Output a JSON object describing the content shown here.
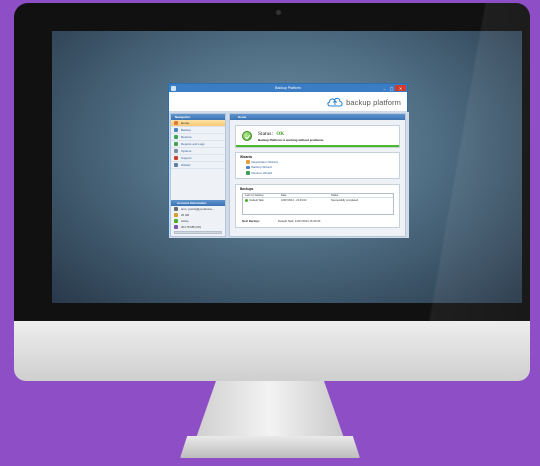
{
  "window": {
    "title": "Backup Platform",
    "controls": {
      "minimize": "–",
      "maximize": "▢",
      "close": "✕"
    }
  },
  "brand": {
    "name": "backup platform",
    "logo_icon": "cloud-upload-icon"
  },
  "nav": {
    "header": "Navigation",
    "items": [
      {
        "label": "Home",
        "icon": "home-icon",
        "color": "#e07b39",
        "active": true
      },
      {
        "label": "Backup",
        "icon": "backup-icon",
        "color": "#4a86c6"
      },
      {
        "label": "Restore",
        "icon": "restore-icon",
        "color": "#3aa35a"
      },
      {
        "label": "Reports and Logs",
        "icon": "report-icon",
        "color": "#4aa058"
      },
      {
        "label": "Options",
        "icon": "options-icon",
        "color": "#7a8fa6"
      },
      {
        "label": "Support",
        "icon": "support-icon",
        "color": "#c8402e"
      },
      {
        "label": "Wizard",
        "icon": "wizard-icon",
        "color": "#5c7fa8"
      }
    ]
  },
  "account": {
    "header": "Account Information",
    "rows": [
      {
        "text": "acm: yourdo@yourdoma...",
        "icon": "user-icon",
        "color": "#6b6b6b"
      },
      {
        "text": "25 GB",
        "icon": "storage-icon",
        "color": "#d89b2b"
      },
      {
        "text": "Active",
        "icon": "active-icon",
        "color": "#4fae2d"
      },
      {
        "text": "204.78 MB (0%)",
        "icon": "usage-icon",
        "color": "#7a55b5"
      }
    ]
  },
  "main": {
    "header": "Home",
    "status": {
      "label": "Status:",
      "value": "OK",
      "message": "Backup Platform is working without problems."
    },
    "wizards": {
      "title": "Wizards",
      "items": [
        {
          "label": "Registration Wizard",
          "color": "#e3a33a"
        },
        {
          "label": "Backup Wizard",
          "color": "#4a86c6"
        },
        {
          "label": "Restore Wizard",
          "color": "#3aa35a"
        }
      ]
    },
    "backups": {
      "title": "Backups",
      "columns": [
        "Last run backup",
        "Date",
        "Status"
      ],
      "rows": [
        {
          "name": "Default Task",
          "date": "10/07/2014 - 22:40:02",
          "status": "Successfully completed"
        }
      ],
      "next_label": "Next Backup:",
      "next_value": "Default Task: 11/07/2014 15:40:00"
    }
  }
}
